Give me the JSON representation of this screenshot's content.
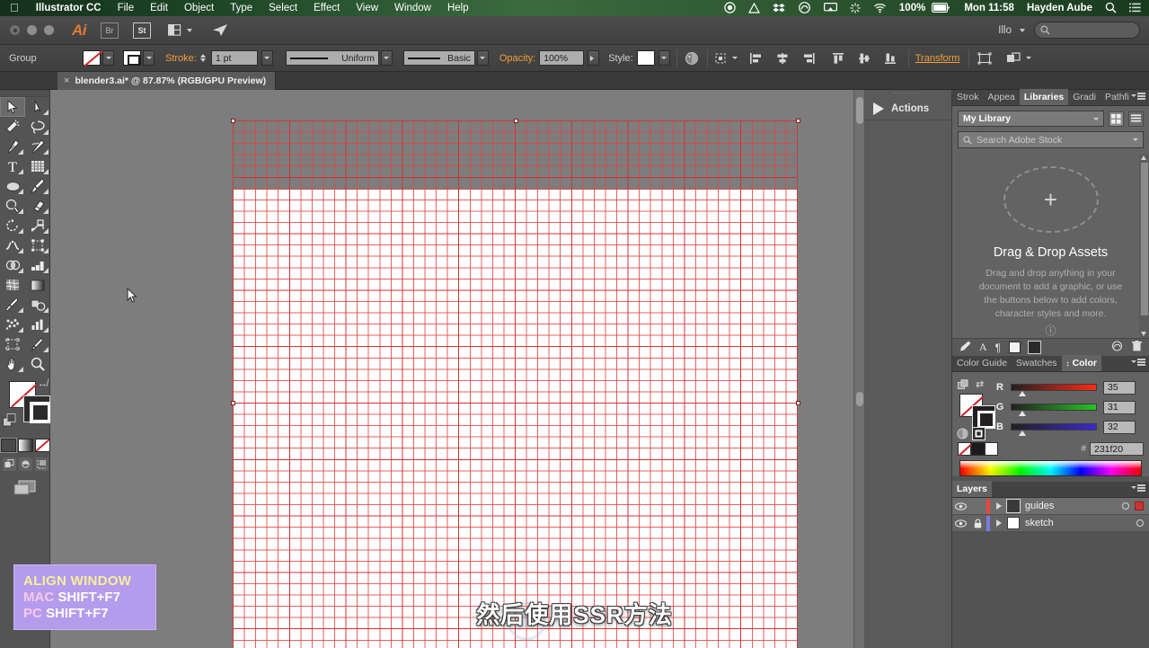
{
  "menubar": {
    "apple_icon": "apple-logo-icon",
    "app_name": "Illustrator CC",
    "items": [
      "File",
      "Edit",
      "Object",
      "Type",
      "Select",
      "Effect",
      "View",
      "Window",
      "Help"
    ],
    "status_icons": [
      "record-icon",
      "google-drive-icon",
      "dropbox-icon",
      "creative-cloud-icon",
      "airplay-icon",
      "sync-spinner-icon",
      "wifi-icon"
    ],
    "battery_percent": "100%",
    "battery_icon": "battery-charging-icon",
    "clock": "Mon 11:58",
    "user": "Hayden Aube",
    "search_icon": "search-icon",
    "notification_icon": "notification-center-icon"
  },
  "appbar": {
    "logo": "Ai",
    "bridge_label": "Br",
    "stock_label": "St",
    "arrange_label": "arrange-documents-icon",
    "share_label": "share-on-behance-icon",
    "workspace": "Illo",
    "search_placeholder": ""
  },
  "control": {
    "selection_label": "Group",
    "fill_swatch": "none",
    "stroke_swatch": "black",
    "stroke_label": "Stroke:",
    "stroke_weight": "1 pt",
    "profile_label": "Uniform",
    "brush_label": "Basic",
    "opacity_label": "Opacity:",
    "opacity_value": "100%",
    "style_label": "Style:",
    "recolor_icon": "recolor-artwork-icon",
    "align_icons": [
      "align-selection-icon",
      "align-left-icon",
      "align-horizontal-center-icon",
      "align-right-icon",
      "align-top-icon",
      "align-vertical-center-icon",
      "align-bottom-icon"
    ],
    "transform_label": "Transform",
    "isolate_icon": "isolate-group-icon",
    "shape_icon": "shape-options-icon"
  },
  "document": {
    "tab_title": "blender3.ai* @ 87.87% (RGB/GPU Preview)",
    "close_icon": "close-tab-icon"
  },
  "tools": {
    "items": [
      {
        "name": "selection-tool",
        "glyph": "selection",
        "selected": true
      },
      {
        "name": "direct-selection-tool",
        "glyph": "direct-selection",
        "selected": false
      },
      {
        "name": "magic-wand-tool",
        "glyph": "magic-wand",
        "selected": false
      },
      {
        "name": "lasso-tool",
        "glyph": "lasso",
        "selected": false
      },
      {
        "name": "pen-tool",
        "glyph": "pen",
        "selected": false
      },
      {
        "name": "curvature-tool",
        "glyph": "curvature",
        "selected": false
      },
      {
        "name": "type-tool",
        "glyph": "type",
        "selected": false
      },
      {
        "name": "touch-type-tool",
        "glyph": "grid",
        "selected": false
      },
      {
        "name": "line-segment-tool",
        "glyph": "ellipse",
        "selected": false
      },
      {
        "name": "paintbrush-tool",
        "glyph": "paintbrush",
        "selected": false
      },
      {
        "name": "shaper-tool",
        "glyph": "shaper",
        "selected": false
      },
      {
        "name": "eraser-tool",
        "glyph": "eraser",
        "selected": false
      },
      {
        "name": "rotate-tool",
        "glyph": "rotate",
        "selected": false
      },
      {
        "name": "scale-tool",
        "glyph": "scale",
        "selected": false
      },
      {
        "name": "width-tool",
        "glyph": "width",
        "selected": false
      },
      {
        "name": "free-transform-tool",
        "glyph": "free-transform",
        "selected": false
      },
      {
        "name": "shape-builder-tool",
        "glyph": "shape-builder",
        "selected": false
      },
      {
        "name": "perspective-grid-tool",
        "glyph": "perspective",
        "selected": false
      },
      {
        "name": "mesh-tool",
        "glyph": "mesh",
        "selected": false
      },
      {
        "name": "gradient-tool",
        "glyph": "gradient",
        "selected": false
      },
      {
        "name": "eyedropper-tool",
        "glyph": "eyedropper",
        "selected": false
      },
      {
        "name": "blend-tool",
        "glyph": "blend",
        "selected": false
      },
      {
        "name": "symbol-sprayer-tool",
        "glyph": "symbol-sprayer",
        "selected": false
      },
      {
        "name": "column-graph-tool",
        "glyph": "column-graph",
        "selected": false
      },
      {
        "name": "artboard-tool",
        "glyph": "artboard",
        "selected": false
      },
      {
        "name": "slice-tool",
        "glyph": "slice",
        "selected": false
      },
      {
        "name": "hand-tool",
        "glyph": "hand",
        "selected": false
      },
      {
        "name": "zoom-tool",
        "glyph": "zoom",
        "selected": false
      }
    ],
    "fill_state": "none",
    "stroke_state": "black",
    "swap_icon": "swap-fill-stroke-icon",
    "default_icon": "default-fill-stroke-icon",
    "drawing_modes": [
      "draw-normal-icon",
      "draw-behind-icon",
      "draw-inside-icon"
    ],
    "screen_mode_icon": "change-screen-mode-icon"
  },
  "canvas": {
    "zoom": "87.87%",
    "grid_color": "#e04646",
    "artboard_background": "#ffffff",
    "pasteboard_color": "#7d7d7d",
    "cursor_icon": "arrow-cursor"
  },
  "actions_panel": {
    "title": "Actions",
    "icon": "play-triangle-icon"
  },
  "dock": {
    "top_tabs": [
      {
        "label": "Strok",
        "active": false,
        "name": "tab-stroke"
      },
      {
        "label": "Appea",
        "active": false,
        "name": "tab-appearance"
      },
      {
        "label": "Libraries",
        "active": true,
        "name": "tab-libraries"
      },
      {
        "label": "Gradi",
        "active": false,
        "name": "tab-gradient"
      },
      {
        "label": "Pathfi",
        "active": false,
        "name": "tab-pathfinder"
      }
    ],
    "libraries": {
      "selected_library": "My Library",
      "search_placeholder": "Search Adobe Stock",
      "search_icon": "search-icon",
      "grid_view_icon": "grid-view-icon",
      "list_view_icon": "list-view-icon",
      "plus_icon": "add-asset-icon",
      "empty_title": "Drag & Drop Assets",
      "empty_description": "Drag and drop anything in your document to add a graphic, or use the buttons below to add colors, character styles and more.",
      "help_icon": "help-circle-icon",
      "footer_icons": [
        "add-fill-color-icon",
        "add-character-style-icon",
        "add-paragraph-style-icon",
        "add-color-light-icon",
        "add-color-dark-icon",
        "library-options-icon",
        "delete-icon"
      ]
    },
    "color_tabs": [
      {
        "label": "Color Guide",
        "active": false,
        "name": "tab-color-guide"
      },
      {
        "label": "Swatches",
        "active": false,
        "name": "tab-swatches"
      },
      {
        "label": "Color",
        "active": true,
        "name": "tab-color"
      }
    ],
    "color": {
      "channels": [
        {
          "label": "R",
          "value": "35"
        },
        {
          "label": "G",
          "value": "31"
        },
        {
          "label": "B",
          "value": "32"
        }
      ],
      "hex_symbol": "#",
      "hex_value": "231f20",
      "fill_state": "none",
      "stroke_state": "#231f20",
      "swap_icon": "swap-fill-stroke-icon",
      "spectrum_icon": "color-spectrum-ramp"
    },
    "layers": {
      "title": "Layers",
      "rows": [
        {
          "name": "guides",
          "visible": true,
          "locked": false,
          "color": "#e8453c",
          "selected": true,
          "thumb": "#3a3a3a",
          "target_icon": "target-circle-icon",
          "has_selection_square": true
        },
        {
          "name": "sketch",
          "visible": true,
          "locked": true,
          "color": "#7b7ce0",
          "selected": false,
          "thumb": "#ffffff",
          "target_icon": "target-circle-icon",
          "has_selection_square": false
        }
      ],
      "eye_icon": "eye-icon",
      "lock_icon": "lock-icon",
      "expand_icon": "disclosure-triangle-icon"
    }
  },
  "overlay": {
    "hint_title": "ALIGN WINDOW",
    "hint_mac_platform": "MAC",
    "hint_mac_keys": "SHIFT+F7",
    "hint_pc_platform": "PC",
    "hint_pc_keys": "SHIFT+F7",
    "hint_bg": "#b49bec",
    "hint_title_color": "#f6f09a",
    "subtitle": "然后使用SSR方法"
  }
}
